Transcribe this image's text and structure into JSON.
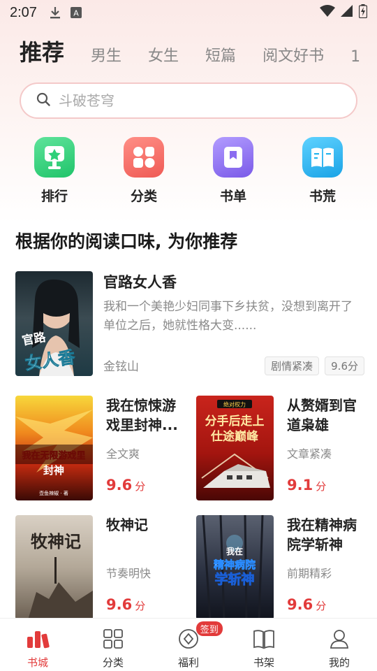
{
  "status_bar": {
    "time": "2:07",
    "icons": [
      "download-icon",
      "accessibility-icon",
      "wifi-icon",
      "signal-icon",
      "battery-charging-icon"
    ]
  },
  "tabs": [
    {
      "label": "推荐",
      "active": true
    },
    {
      "label": "男生"
    },
    {
      "label": "女生"
    },
    {
      "label": "短篇"
    },
    {
      "label": "阅文好书"
    },
    {
      "label": "1"
    }
  ],
  "search": {
    "placeholder": "斗破苍穹",
    "icon": "search-icon"
  },
  "quick_links": [
    {
      "label": "排行",
      "icon": "ranking-icon",
      "color": "#2ecf79"
    },
    {
      "label": "分类",
      "icon": "category-icon",
      "color": "#f46b66"
    },
    {
      "label": "书单",
      "icon": "booklist-icon",
      "color": "#8b6cf0"
    },
    {
      "label": "书荒",
      "icon": "book-shortage-icon",
      "color": "#25b5ee"
    }
  ],
  "section_title": "根据你的阅读口味, 为你推荐",
  "featured": {
    "title": "官路女人香",
    "description": "我和一个美艳少妇同事下乡扶贫，没想到离开了单位之后，她就性格大变......",
    "author": "金铉山",
    "tags": [
      "剧情紧凑",
      "9.6分"
    ],
    "cover_text": [
      "官路",
      "女人香"
    ]
  },
  "books": [
    {
      "title": "我在惊悚游戏里封神...",
      "subtitle": "全文爽",
      "score": "9.6",
      "unit": "分",
      "cover_text": [
        "我在无限游戏里",
        "封神"
      ],
      "cover_author": "壶鱼辣椒 · 著"
    },
    {
      "title": "从赘婿到官道枭雄",
      "subtitle": "文章紧凑",
      "score": "9.1",
      "unit": "分",
      "cover_text": [
        "绝对权力",
        "分手后走上",
        "仕途巅峰"
      ]
    },
    {
      "title": "牧神记",
      "subtitle": "节奏明快",
      "score": "9.6",
      "unit": "分",
      "cover_text": [
        "牧神记"
      ]
    },
    {
      "title": "我在精神病院学斩神",
      "subtitle": "前期精彩",
      "score": "9.6",
      "unit": "分",
      "cover_text": [
        "我在",
        "精神病院",
        "学斩神"
      ]
    }
  ],
  "bottom_nav": [
    {
      "label": "书城",
      "icon": "bookstore-icon",
      "active": true
    },
    {
      "label": "分类",
      "icon": "grid-icon"
    },
    {
      "label": "福利",
      "icon": "welfare-icon",
      "badge": "签到"
    },
    {
      "label": "书架",
      "icon": "bookshelf-icon"
    },
    {
      "label": "我的",
      "icon": "profile-icon"
    }
  ],
  "colors": {
    "accent": "#e23b3b",
    "search_border": "#f4c9c9"
  }
}
